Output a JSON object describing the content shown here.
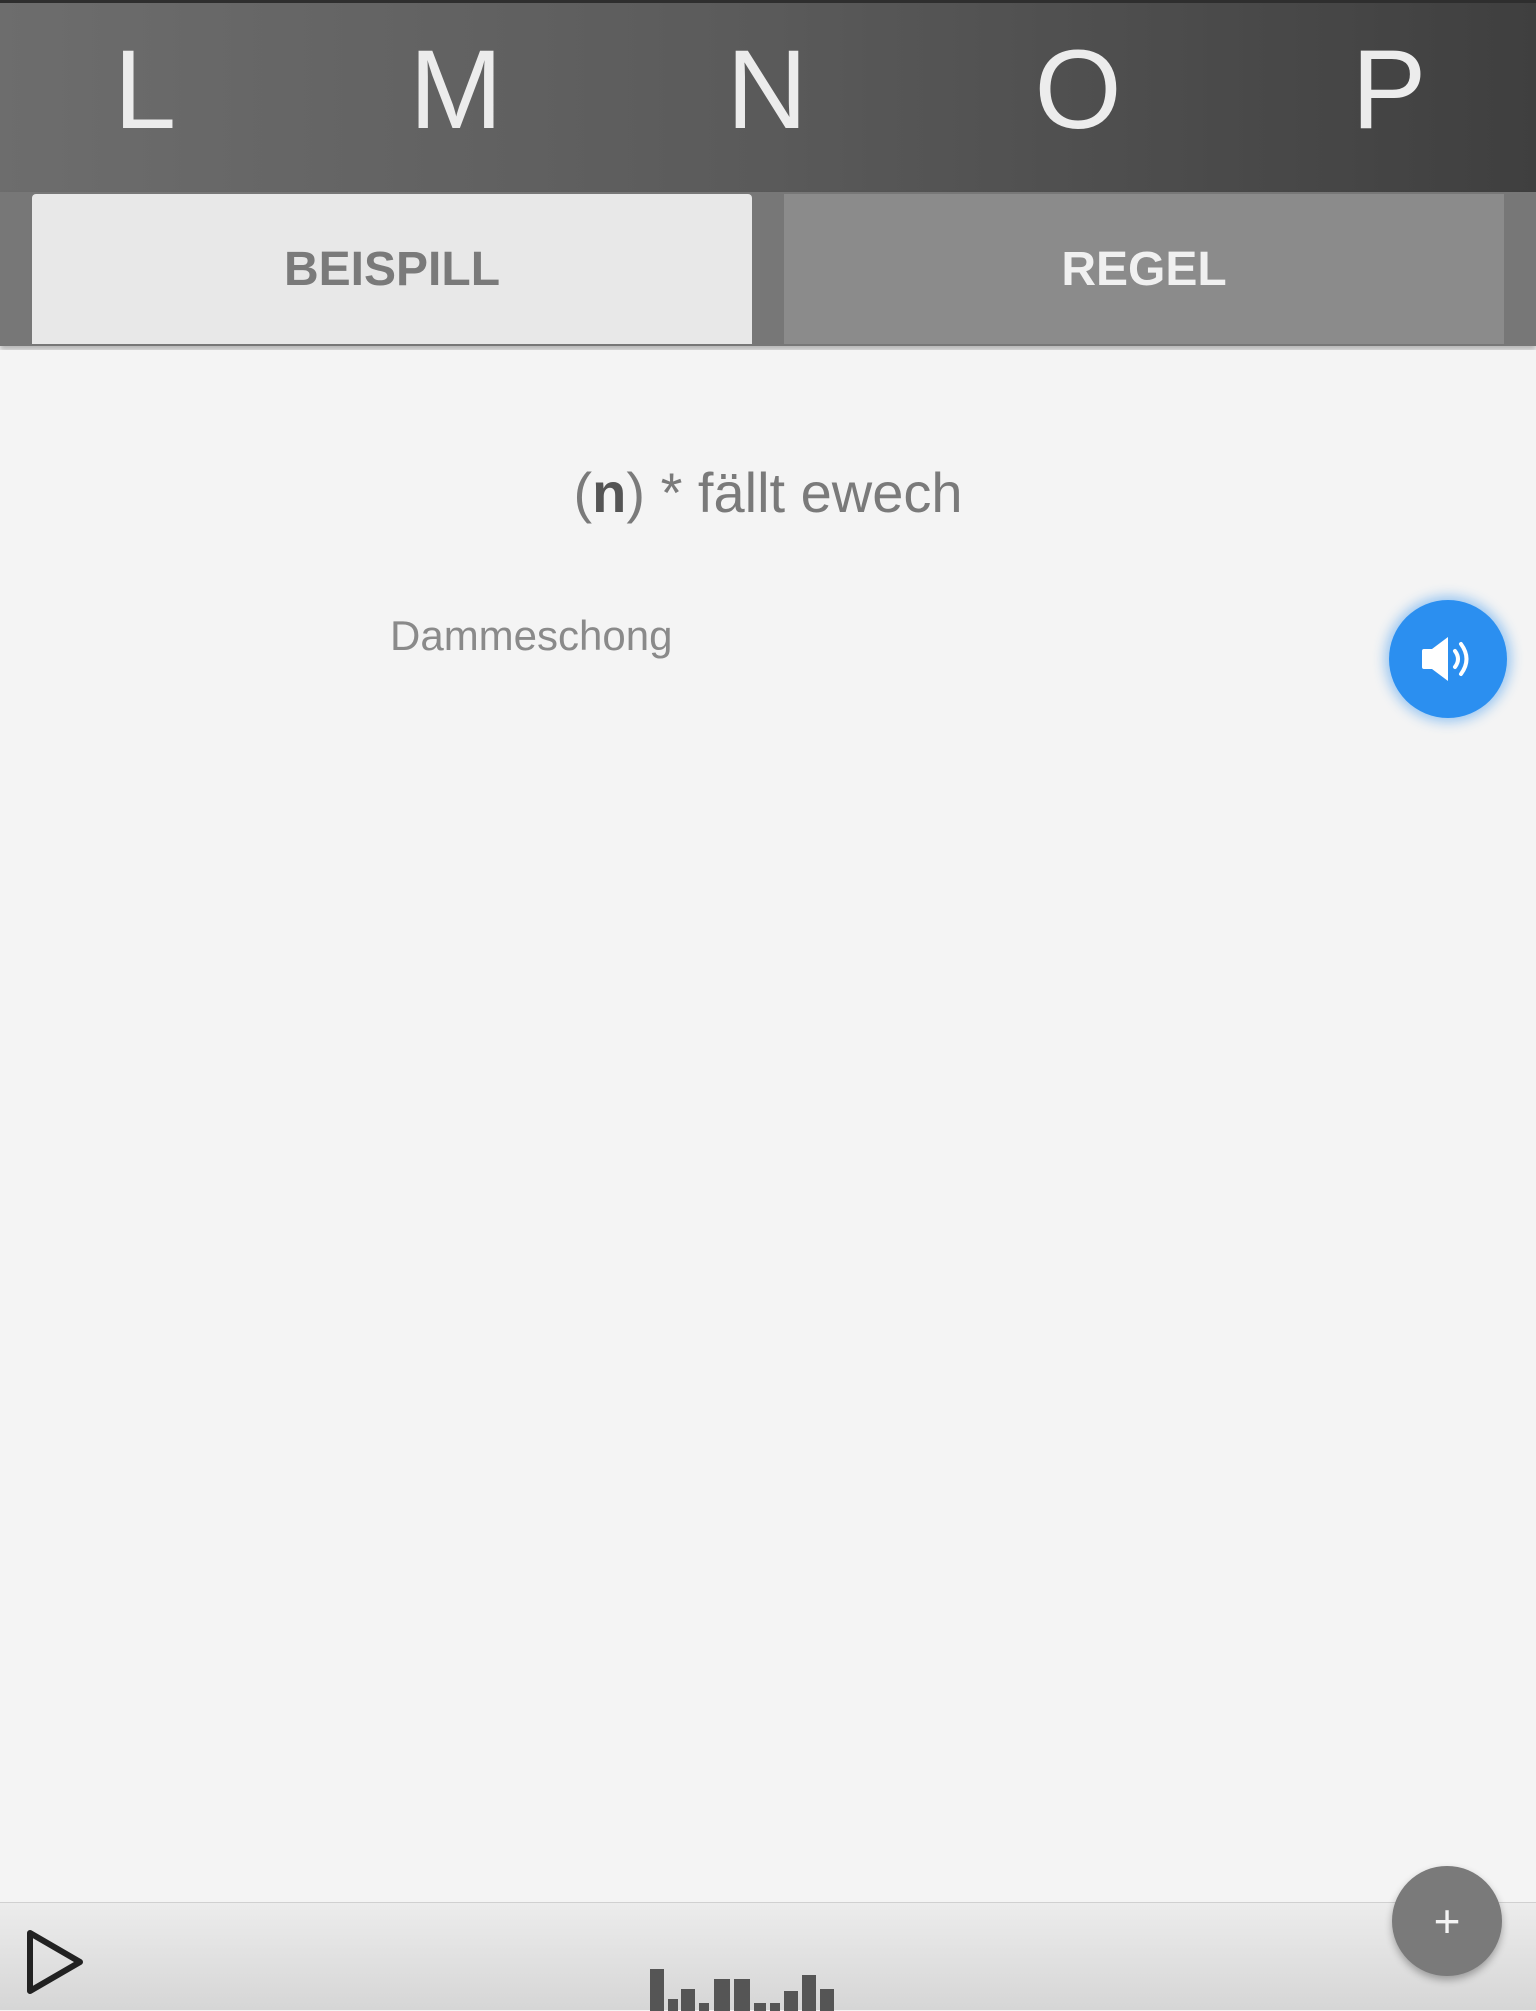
{
  "letters": [
    "L",
    "M",
    "N",
    "O",
    "P"
  ],
  "tabs": {
    "example_label": "BEISPILL",
    "rule_label": "REGEL",
    "active": "BEISPILL"
  },
  "rule": {
    "open_paren": "(",
    "letter": "n",
    "rest": ") * fällt ewech"
  },
  "example": {
    "word": "Dammeschong"
  },
  "buttons": {
    "add_label": "+"
  },
  "colors": {
    "accent": "#2b8ff0",
    "header": "#5a5a5a",
    "tab_active": "#e8e8e8",
    "tab_inactive": "#8b8b8b"
  },
  "icons": {
    "sound": "speaker-volume-icon",
    "play": "play-icon",
    "meter": "audio-level-icon",
    "add": "plus-icon"
  }
}
